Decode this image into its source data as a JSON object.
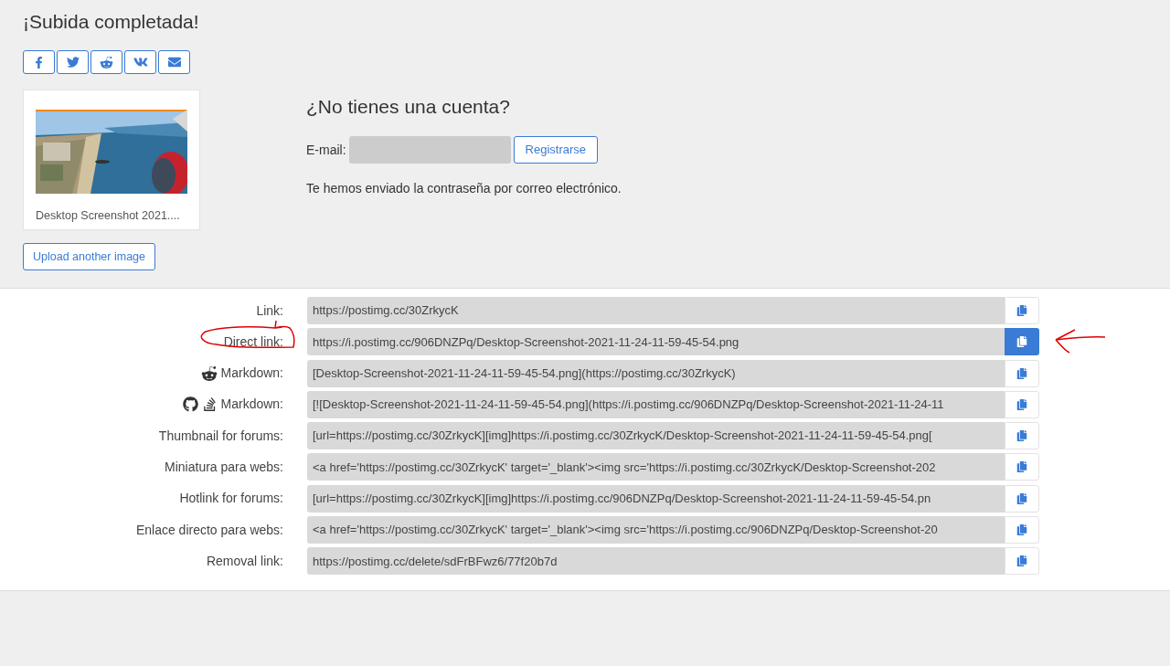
{
  "title": "¡Subida completada!",
  "thumbnail": {
    "kind": "picture",
    "caption": "Desktop Screenshot 2021...."
  },
  "upload_another": "Upload another image",
  "account": {
    "heading": "¿No tienes una cuenta?",
    "email_label": "E-mail:",
    "register_button": "Registrarse",
    "note": "Te hemos enviado la contraseña por correo electrónico."
  },
  "links": [
    {
      "kind": "plain",
      "label": "Link:",
      "value": "https://postimg.cc/30ZrkycK",
      "selected": false,
      "annotated": false
    },
    {
      "kind": "plain",
      "label": "Direct link:",
      "value": "https://i.postimg.cc/906DNZPq/Desktop-Screenshot-2021-11-24-11-59-45-54.png",
      "selected": true,
      "annotated": true
    },
    {
      "kind": "reddit",
      "label": "Markdown:",
      "value": "[Desktop-Screenshot-2021-11-24-11-59-45-54.png](https://postimg.cc/30ZrkycK)",
      "selected": false,
      "annotated": false
    },
    {
      "kind": "github",
      "label": "Markdown:",
      "value": "[![Desktop-Screenshot-2021-11-24-11-59-45-54.png](https://i.postimg.cc/906DNZPq/Desktop-Screenshot-2021-11-24-11",
      "selected": false,
      "annotated": false
    },
    {
      "kind": "plain",
      "label": "Thumbnail for forums:",
      "value": "[url=https://postimg.cc/30ZrkycK][img]https://i.postimg.cc/30ZrkycK/Desktop-Screenshot-2021-11-24-11-59-45-54.png[",
      "selected": false,
      "annotated": false
    },
    {
      "kind": "plain",
      "label": "Miniatura para webs:",
      "value": "<a href='https://postimg.cc/30ZrkycK' target='_blank'><img src='https://i.postimg.cc/30ZrkycK/Desktop-Screenshot-202",
      "selected": false,
      "annotated": false
    },
    {
      "kind": "plain",
      "label": "Hotlink for forums:",
      "value": "[url=https://postimg.cc/30ZrkycK][img]https://i.postimg.cc/906DNZPq/Desktop-Screenshot-2021-11-24-11-59-45-54.pn",
      "selected": false,
      "annotated": false
    },
    {
      "kind": "plain",
      "label": "Enlace directo para webs:",
      "value": "<a href='https://postimg.cc/30ZrkycK' target='_blank'><img src='https://i.postimg.cc/906DNZPq/Desktop-Screenshot-20",
      "selected": false,
      "annotated": false
    },
    {
      "kind": "plain",
      "label": "Removal link:",
      "value": "https://postimg.cc/delete/sdFrBFwz6/77f20b7d",
      "selected": false,
      "annotated": false
    }
  ]
}
